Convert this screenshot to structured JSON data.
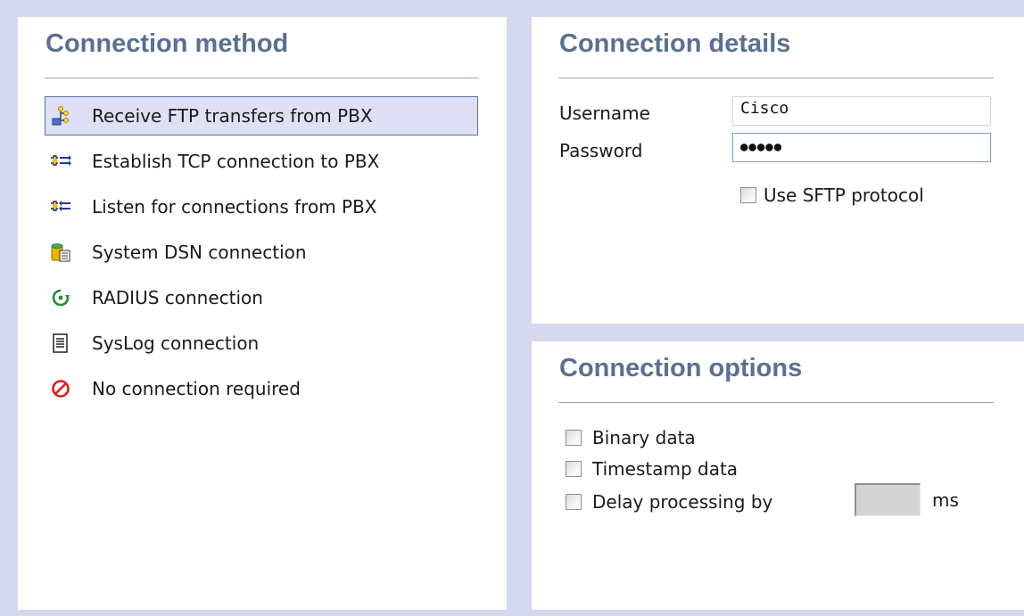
{
  "connection_method": {
    "title": "Connection method",
    "selected": 0,
    "items": [
      {
        "label": "Receive FTP transfers from PBX",
        "icon": "ftp-transfer-icon"
      },
      {
        "label": "Establish TCP connection to PBX",
        "icon": "tcp-outbound-icon"
      },
      {
        "label": "Listen for connections from PBX",
        "icon": "tcp-listen-icon"
      },
      {
        "label": "System DSN connection",
        "icon": "database-icon"
      },
      {
        "label": "RADIUS connection",
        "icon": "radius-icon"
      },
      {
        "label": "SysLog connection",
        "icon": "syslog-document-icon"
      },
      {
        "label": "No connection required",
        "icon": "no-connection-icon"
      }
    ]
  },
  "connection_details": {
    "title": "Connection details",
    "username_label": "Username",
    "username_value": "Cisco",
    "password_label": "Password",
    "password_value": "●●●●●",
    "sftp_label": "Use SFTP protocol",
    "sftp_checked": false
  },
  "connection_options": {
    "title": "Connection options",
    "binary_label": "Binary data",
    "timestamp_label": "Timestamp data",
    "delay_label": "Delay processing by",
    "delay_value": "",
    "delay_unit": "ms"
  },
  "colors": {
    "background": "#d6d8ee",
    "title": "#5a6f92",
    "selection_fill": "#dfe0f5",
    "selection_border": "#5a72a8"
  }
}
